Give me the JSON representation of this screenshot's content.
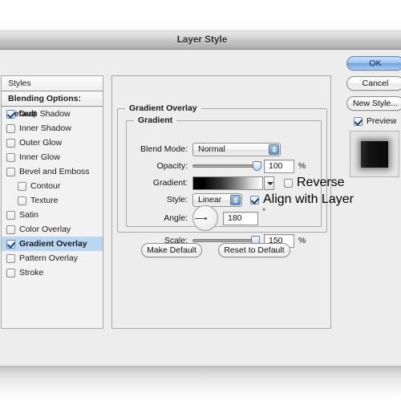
{
  "window": {
    "title": "Layer Style"
  },
  "styles_panel": {
    "header_label": "Styles",
    "blending_options_label": "Blending Options: Default",
    "effects": [
      {
        "label": "Drop Shadow",
        "checked": true,
        "indent": false,
        "selected": false
      },
      {
        "label": "Inner Shadow",
        "checked": false,
        "indent": false,
        "selected": false
      },
      {
        "label": "Outer Glow",
        "checked": false,
        "indent": false,
        "selected": false
      },
      {
        "label": "Inner Glow",
        "checked": false,
        "indent": false,
        "selected": false
      },
      {
        "label": "Bevel and Emboss",
        "checked": false,
        "indent": false,
        "selected": false
      },
      {
        "label": "Contour",
        "checked": false,
        "indent": true,
        "selected": false
      },
      {
        "label": "Texture",
        "checked": false,
        "indent": true,
        "selected": false
      },
      {
        "label": "Satin",
        "checked": false,
        "indent": false,
        "selected": false
      },
      {
        "label": "Color Overlay",
        "checked": false,
        "indent": false,
        "selected": false
      },
      {
        "label": "Gradient Overlay",
        "checked": true,
        "indent": false,
        "selected": true
      },
      {
        "label": "Pattern Overlay",
        "checked": false,
        "indent": false,
        "selected": false
      },
      {
        "label": "Stroke",
        "checked": false,
        "indent": false,
        "selected": false
      }
    ]
  },
  "main_panel": {
    "section_title": "Gradient Overlay",
    "group_title": "Gradient",
    "blend_mode": {
      "label": "Blend Mode:",
      "value": "Normal"
    },
    "opacity": {
      "label": "Opacity:",
      "value": "100",
      "unit": "%",
      "slider_percent": 100
    },
    "gradient": {
      "label": "Gradient:",
      "from_color": "#000000",
      "to_color": "#ffffff",
      "reverse_label": "Reverse",
      "reverse_checked": false
    },
    "style": {
      "label": "Style:",
      "value": "Linear",
      "align_label": "Align with Layer",
      "align_checked": true
    },
    "angle": {
      "label": "Angle:",
      "value": "180",
      "unit": "°"
    },
    "scale": {
      "label": "Scale:",
      "value": "150",
      "unit": "%",
      "slider_percent": 98
    },
    "make_default_label": "Make Default",
    "reset_to_default_label": "Reset to Default"
  },
  "right_column": {
    "ok_label": "OK",
    "cancel_label": "Cancel",
    "new_style_label": "New Style...",
    "preview_label": "Preview",
    "preview_checked": true
  }
}
